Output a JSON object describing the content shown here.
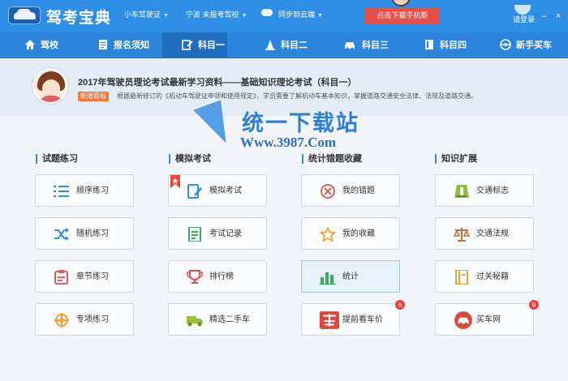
{
  "app": {
    "title": "驾考宝典",
    "car_type": "小车驾驶证",
    "region": "宁波 未报考驾校",
    "sync": "同步到云端",
    "download": "点击下载手机新",
    "login": "请登录"
  },
  "nav": [
    {
      "label": "驾校",
      "icon": "home-icon"
    },
    {
      "label": "报名须知",
      "icon": "document-icon"
    },
    {
      "label": "科目一",
      "icon": "edit-icon"
    },
    {
      "label": "科目二",
      "icon": "cone-icon"
    },
    {
      "label": "科目三",
      "icon": "car-icon"
    },
    {
      "label": "科目四",
      "icon": "book-icon"
    },
    {
      "label": "新手买车",
      "icon": "steering-wheel-icon"
    }
  ],
  "banner": {
    "title": "2017年驾驶员理论考试最新学习资料——基础知识理论考试（科目一）",
    "tag": "新增目标",
    "desc": "根据最新修订的《机动车驾驶证申领和使用规定》，学员需要了解机动车基本知识，掌握道路交通安全法律、法规及道路交通。"
  },
  "watermark": {
    "title": "统一下载站",
    "url": "Www.3987.Com"
  },
  "sections": [
    {
      "title": "试题练习",
      "items": [
        {
          "label": "顺序练习",
          "icon": "list-icon"
        },
        {
          "label": "随机练习",
          "icon": "shuffle-icon"
        },
        {
          "label": "章节练习",
          "icon": "chapter-icon"
        },
        {
          "label": "专项练习",
          "icon": "target-icon"
        }
      ]
    },
    {
      "title": "模拟考试",
      "items": [
        {
          "label": "模拟考试",
          "icon": "exam-icon"
        },
        {
          "label": "考试记录",
          "icon": "record-icon"
        },
        {
          "label": "排行榜",
          "icon": "trophy-icon"
        },
        {
          "label": "精选二手车",
          "icon": "truck-icon"
        }
      ]
    },
    {
      "title": "统计错题收藏",
      "items": [
        {
          "label": "我的错题",
          "icon": "wrong-icon"
        },
        {
          "label": "我的收藏",
          "icon": "star-icon"
        },
        {
          "label": "统计",
          "icon": "bar-chart-icon"
        },
        {
          "label": "提前看车价",
          "icon": "car-price-icon",
          "badge": "6"
        }
      ]
    },
    {
      "title": "知识扩展",
      "items": [
        {
          "label": "交通标志",
          "icon": "traffic-sign-icon"
        },
        {
          "label": "交通法规",
          "icon": "scales-icon"
        },
        {
          "label": "过关秘籍",
          "icon": "secret-book-icon"
        },
        {
          "label": "买车网",
          "icon": "car-buy-icon",
          "badge": "9"
        }
      ]
    }
  ],
  "colors": {
    "titlebar": "#2f8ee6",
    "navbar": "#2b85dc",
    "accent_red": "#e8413b"
  }
}
